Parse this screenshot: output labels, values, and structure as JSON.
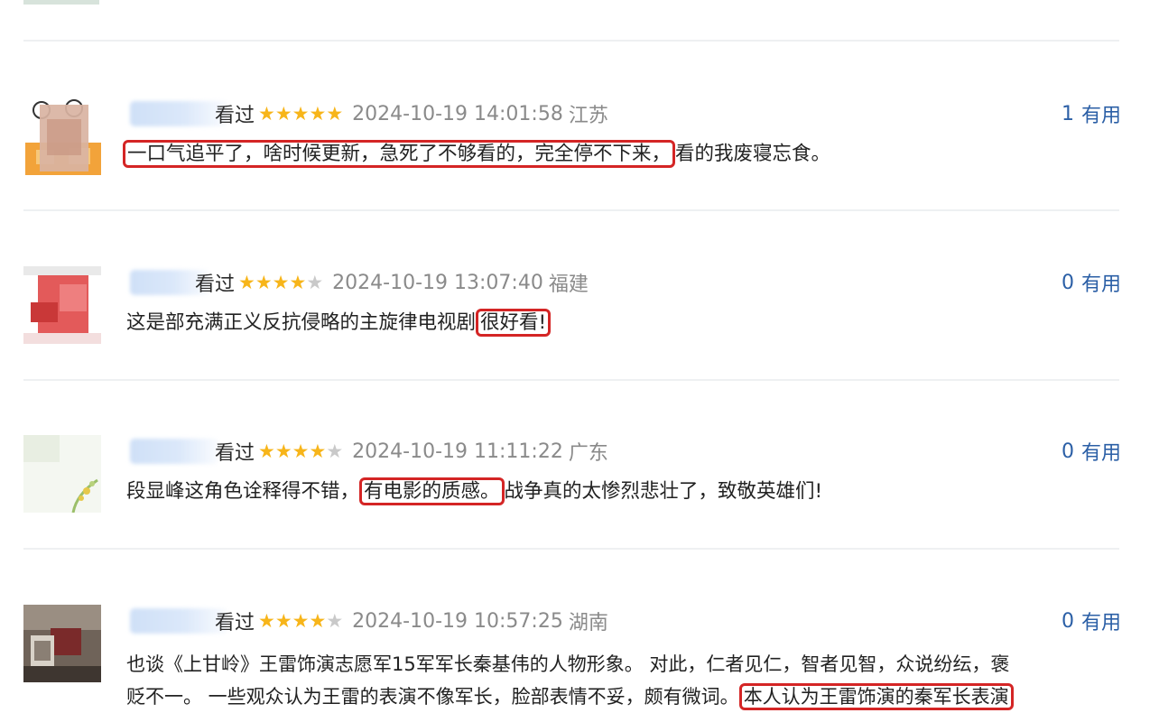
{
  "reviews": [
    {
      "watched_label": "看过",
      "rating": 5,
      "time": "2024-10-19 14:01:58",
      "region": "江苏",
      "useful_count": "1",
      "useful_label": "有用",
      "content_highlight": "一口气追平了，啥时候更新，急死了不够看的，完全停不下来，",
      "content_rest": "看的我废寝忘食。"
    },
    {
      "watched_label": "看过",
      "rating": 4,
      "time": "2024-10-19 13:07:40",
      "region": "福建",
      "useful_count": "0",
      "useful_label": "有用",
      "content_pre": "这是部充满正义反抗侵略的主旋律电视剧",
      "content_highlight": "很好看!"
    },
    {
      "watched_label": "看过",
      "rating": 4,
      "time": "2024-10-19 11:11:22",
      "region": "广东",
      "useful_count": "0",
      "useful_label": "有用",
      "content_pre": "段显峰这角色诠释得不错，",
      "content_highlight": "有电影的质感。",
      "content_post": "战争真的太惨烈悲壮了，致敬英雄们!"
    },
    {
      "watched_label": "看过",
      "rating": 4,
      "time": "2024-10-19 10:57:25",
      "region": "湖南",
      "useful_count": "0",
      "useful_label": "有用",
      "content_line1": "也谈《上甘岭》王雷饰演志愿军15军军长秦基伟的人物形象。 对此，仁者见仁，智者见智，众说纷纭，褒",
      "content_line2_pre": "贬不一。 一些观众认为王雷的表演不像军长，脸部表情不妥，颇有微词。",
      "content_highlight": "本人认为王雷饰演的秦军长表演"
    }
  ]
}
